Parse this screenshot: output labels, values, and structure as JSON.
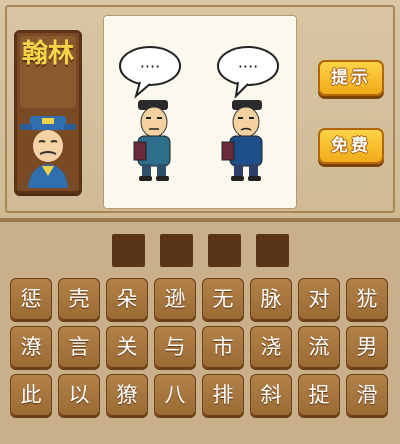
{
  "rank": {
    "title": "翰林"
  },
  "buttons": {
    "hint": "提示",
    "free": "免费"
  },
  "speech": {
    "left": "····",
    "right": "····"
  },
  "answer": {
    "slots": [
      "",
      "",
      "",
      ""
    ]
  },
  "tiles": [
    [
      "惩",
      "壳",
      "朵",
      "逊",
      "无",
      "脉",
      "对",
      "犹"
    ],
    [
      "潦",
      "言",
      "关",
      "与",
      "市",
      "浇",
      "流",
      "男"
    ],
    [
      "此",
      "以",
      "獠",
      "八",
      "排",
      "斜",
      "捉",
      "滑"
    ]
  ]
}
